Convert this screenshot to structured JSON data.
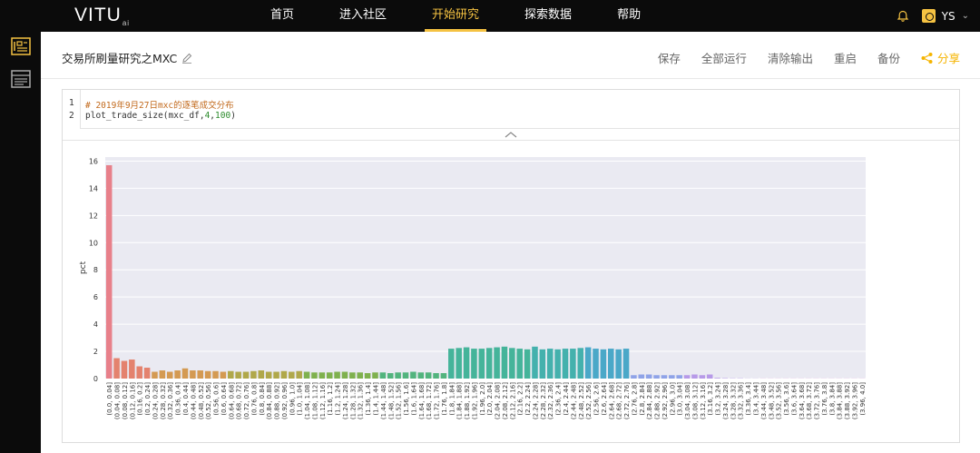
{
  "app": {
    "logo": "VITU",
    "logo_sub": "ai",
    "nav": [
      "首页",
      "进入社区",
      "开始研究",
      "探索数据",
      "帮助"
    ],
    "active_nav": 2,
    "user": "YS"
  },
  "notebook": {
    "title": "交易所刷量研究之MXC",
    "actions": [
      "保存",
      "全部运行",
      "清除输出",
      "重启",
      "备份"
    ],
    "share_label": "分享"
  },
  "code": {
    "line_numbers": [
      "1",
      "2"
    ],
    "comment": "# 2019年9月27日mxc的逐笔成交分布",
    "call_prefix": "plot_trade_size(mxc_df,",
    "arg1": "4",
    "comma": ",",
    "arg2": "100",
    "close": ")"
  },
  "colors": {
    "accent": "#f5c242",
    "share": "#f5b400",
    "topbar": "#0b0b0b",
    "plot_bg": "#eaeaf2"
  },
  "chart_data": {
    "type": "bar",
    "ylabel": "pct",
    "ylim": [
      0,
      16.3
    ],
    "yticks": [
      0,
      2,
      4,
      6,
      8,
      10,
      12,
      14,
      16
    ],
    "grid": true,
    "categories": [
      "(0.0, 0.04]",
      "(0.04, 0.08]",
      "(0.08, 0.12]",
      "(0.12, 0.16]",
      "(0.16, 0.2]",
      "(0.2, 0.24]",
      "(0.24, 0.28]",
      "(0.28, 0.32]",
      "(0.32, 0.36]",
      "(0.36, 0.4]",
      "(0.4, 0.44]",
      "(0.44, 0.48]",
      "(0.48, 0.52]",
      "(0.52, 0.56]",
      "(0.56, 0.6]",
      "(0.6, 0.64]",
      "(0.64, 0.68]",
      "(0.68, 0.72]",
      "(0.72, 0.76]",
      "(0.76, 0.8]",
      "(0.8, 0.84]",
      "(0.84, 0.88]",
      "(0.88, 0.92]",
      "(0.92, 0.96]",
      "(0.96, 1.0]",
      "(1.0, 1.04]",
      "(1.04, 1.08]",
      "(1.08, 1.12]",
      "(1.12, 1.16]",
      "(1.16, 1.2]",
      "(1.2, 1.24]",
      "(1.24, 1.28]",
      "(1.28, 1.32]",
      "(1.32, 1.36]",
      "(1.36, 1.4]",
      "(1.4, 1.44]",
      "(1.44, 1.48]",
      "(1.48, 1.52]",
      "(1.52, 1.56]",
      "(1.56, 1.6]",
      "(1.6, 1.64]",
      "(1.64, 1.68]",
      "(1.68, 1.72]",
      "(1.72, 1.76]",
      "(1.76, 1.8]",
      "(1.8, 1.84]",
      "(1.84, 1.88]",
      "(1.88, 1.92]",
      "(1.92, 1.96]",
      "(1.96, 2.0]",
      "(2.0, 2.04]",
      "(2.04, 2.08]",
      "(2.08, 2.12]",
      "(2.12, 2.16]",
      "(2.16, 2.2]",
      "(2.2, 2.24]",
      "(2.24, 2.28]",
      "(2.28, 2.32]",
      "(2.32, 2.36]",
      "(2.36, 2.4]",
      "(2.4, 2.44]",
      "(2.44, 2.48]",
      "(2.48, 2.52]",
      "(2.52, 2.56]",
      "(2.56, 2.6]",
      "(2.6, 2.64]",
      "(2.64, 2.68]",
      "(2.68, 2.72]",
      "(2.72, 2.76]",
      "(2.76, 2.8]",
      "(2.8, 2.84]",
      "(2.84, 2.88]",
      "(2.88, 2.92]",
      "(2.92, 2.96]",
      "(2.96, 3.0]",
      "(3.0, 3.04]",
      "(3.04, 3.08]",
      "(3.08, 3.12]",
      "(3.12, 3.16]",
      "(3.16, 3.2]",
      "(3.2, 3.24]",
      "(3.24, 3.28]",
      "(3.28, 3.32]",
      "(3.32, 3.36]",
      "(3.36, 3.4]",
      "(3.4, 3.44]",
      "(3.44, 3.48]",
      "(3.48, 3.52]",
      "(3.52, 3.56]",
      "(3.56, 3.6]",
      "(3.6, 3.64]",
      "(3.64, 3.68]",
      "(3.68, 3.72]",
      "(3.72, 3.76]",
      "(3.76, 3.8]",
      "(3.8, 3.84]",
      "(3.84, 3.88]",
      "(3.88, 3.92]",
      "(3.92, 3.96]",
      "(3.96, 4.0]"
    ],
    "values": [
      15.7,
      1.5,
      1.3,
      1.4,
      0.9,
      0.8,
      0.5,
      0.6,
      0.5,
      0.6,
      0.75,
      0.6,
      0.6,
      0.55,
      0.55,
      0.5,
      0.55,
      0.5,
      0.5,
      0.55,
      0.6,
      0.5,
      0.5,
      0.55,
      0.5,
      0.55,
      0.5,
      0.45,
      0.45,
      0.45,
      0.5,
      0.5,
      0.45,
      0.45,
      0.4,
      0.45,
      0.45,
      0.4,
      0.45,
      0.45,
      0.5,
      0.45,
      0.45,
      0.4,
      0.4,
      2.2,
      2.25,
      2.3,
      2.2,
      2.2,
      2.25,
      2.3,
      2.35,
      2.25,
      2.2,
      2.15,
      2.35,
      2.15,
      2.2,
      2.15,
      2.2,
      2.2,
      2.25,
      2.3,
      2.2,
      2.15,
      2.2,
      2.15,
      2.2,
      0.25,
      0.3,
      0.3,
      0.25,
      0.25,
      0.25,
      0.25,
      0.25,
      0.3,
      0.25,
      0.3,
      0.05,
      0.03,
      0.02,
      0.02,
      0.01,
      0.01,
      0.01,
      0.01,
      0.01,
      0.01,
      0.01,
      0.01,
      0.01,
      0.01,
      0.01,
      0.01,
      0.01,
      0.01,
      0.01,
      0.01
    ]
  }
}
